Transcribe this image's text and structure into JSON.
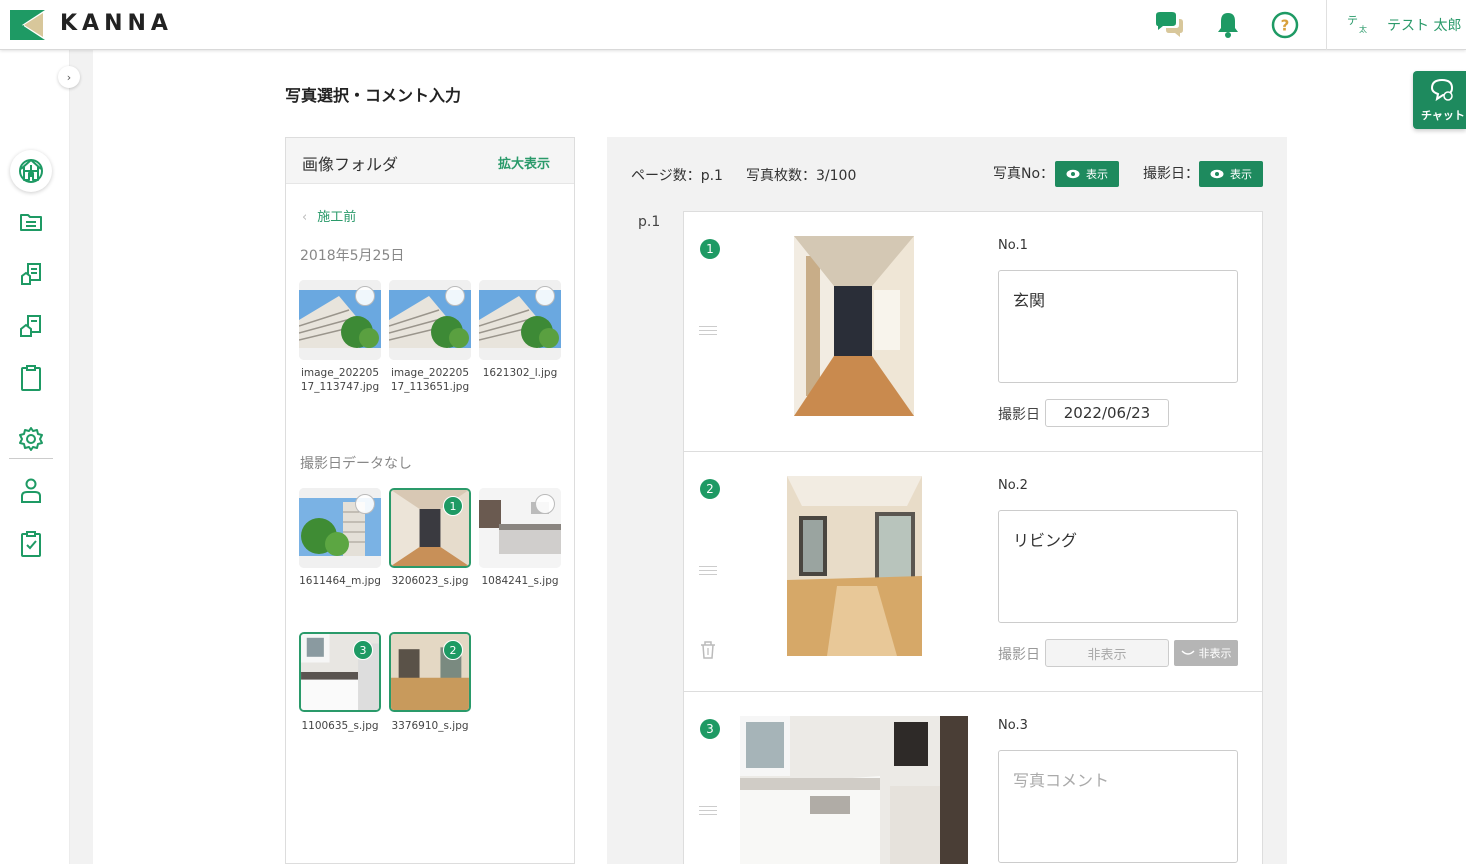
{
  "header": {
    "logo_text": "KANNA",
    "user_avatar_main": "テ",
    "user_avatar_sub": "太",
    "user_name": "テスト 太郎"
  },
  "main": {
    "title": "写真選択・コメント入力"
  },
  "folder": {
    "title": "画像フォルダ",
    "expand_label": "拡大表示",
    "back_label": "施工前",
    "date_section": "2018年5月25日",
    "nodate_section": "撮影日データなし",
    "dated_images": [
      {
        "name": "image_20220517_113747.jpg",
        "caption_l1": "image_202205",
        "caption_l2": "17_113747.jpg"
      },
      {
        "name": "image_20220517_113651.jpg",
        "caption_l1": "image_202205",
        "caption_l2": "17_113651.jpg"
      },
      {
        "name": "1621302_l.jpg",
        "caption_l1": "1621302_l.jpg",
        "caption_l2": ""
      }
    ],
    "undated_images": [
      {
        "caption": "1611464_m.jpg",
        "selected": ""
      },
      {
        "caption": "3206023_s.jpg",
        "selected": "1"
      },
      {
        "caption": "1084241_s.jpg",
        "selected": ""
      },
      {
        "caption": "1100635_s.jpg",
        "selected": "3"
      },
      {
        "caption": "3376910_s.jpg",
        "selected": "2"
      }
    ]
  },
  "editor": {
    "page_count_label": "ページ数：p.1",
    "photo_count_label": "写真枚数：3/100",
    "photo_no_label": "写真No：",
    "shot_date_label": "撮影日：",
    "show_label": "表示",
    "page_label": "p.1",
    "cards": [
      {
        "badge": "1",
        "no": "No.1",
        "comment": "玄関",
        "date_label": "撮影日",
        "date": "2022/06/23"
      },
      {
        "badge": "2",
        "no": "No.2",
        "comment": "リビング",
        "date_label": "撮影日",
        "date": "非表示",
        "hide_label": "非表示"
      },
      {
        "badge": "3",
        "no": "No.3",
        "comment_placeholder": "写真コメント"
      }
    ]
  },
  "chat": {
    "label": "チャット"
  },
  "colors": {
    "accent": "#1e8a5e",
    "accent_light": "#2a9a6a",
    "badge": "#1e9a64"
  }
}
